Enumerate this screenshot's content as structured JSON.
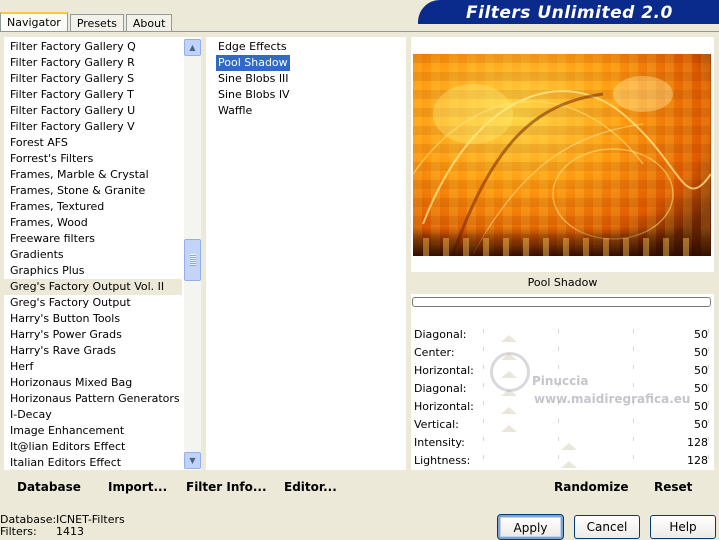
{
  "window": {
    "title": "Filters Unlimited 2.0"
  },
  "tabs": [
    {
      "label": "Navigator",
      "active": true
    },
    {
      "label": "Presets",
      "active": false
    },
    {
      "label": "About",
      "active": false
    }
  ],
  "categories": [
    "Filter Factory Gallery Q",
    "Filter Factory Gallery R",
    "Filter Factory Gallery S",
    "Filter Factory Gallery T",
    "Filter Factory Gallery U",
    "Filter Factory Gallery V",
    "Forest AFS",
    "Forrest's Filters",
    "Frames, Marble & Crystal",
    "Frames, Stone & Granite",
    "Frames, Textured",
    "Frames, Wood",
    "Freeware filters",
    "Gradients",
    "Graphics Plus",
    "Greg's Factory Output Vol. II",
    "Greg's Factory Output",
    "Harry's Button Tools",
    "Harry's Power Grads",
    "Harry's Rave Grads",
    "Herf",
    "Horizonaus Mixed Bag",
    "Horizonaus Pattern Generators",
    "I-Decay",
    "Image Enhancement",
    "It@lian Editors Effect",
    "Italian Editors Effect"
  ],
  "selected_category": "Greg's Factory Output Vol. II",
  "filters": [
    "Edge Effects",
    "Pool Shadow",
    "Sine Blobs III",
    "Sine Blobs IV",
    "Waffle"
  ],
  "selected_filter": "Pool Shadow",
  "preview": {
    "filter_name": "Pool Shadow",
    "progress": 0
  },
  "params": [
    {
      "label": "Diagonal:",
      "value": "50",
      "level": 0.2
    },
    {
      "label": "Center:",
      "value": "50",
      "level": 0.2
    },
    {
      "label": "Horizontal:",
      "value": "50",
      "level": 0.2
    },
    {
      "label": "Diagonal:",
      "value": "50",
      "level": 0.2
    },
    {
      "label": "Horizontal:",
      "value": "50",
      "level": 0.2
    },
    {
      "label": "Vertical:",
      "value": "50",
      "level": 0.2
    },
    {
      "label": "Intensity:",
      "value": "128",
      "level": 0.5
    },
    {
      "label": "Lightness:",
      "value": "128",
      "level": 0.5
    }
  ],
  "toolbar": {
    "database": "Database",
    "import": "Import...",
    "filter_info": "Filter Info...",
    "editor": "Editor...",
    "randomize": "Randomize",
    "reset": "Reset"
  },
  "status": {
    "database_label": "Database:",
    "database_value": "ICNET-Filters",
    "filters_label": "Filters:",
    "filters_value": "1413"
  },
  "buttons": {
    "apply": "Apply",
    "cancel": "Cancel",
    "help": "Help"
  },
  "watermark": {
    "line1": "Pinuccia",
    "line2": "www.maidiregrafica.eu"
  }
}
